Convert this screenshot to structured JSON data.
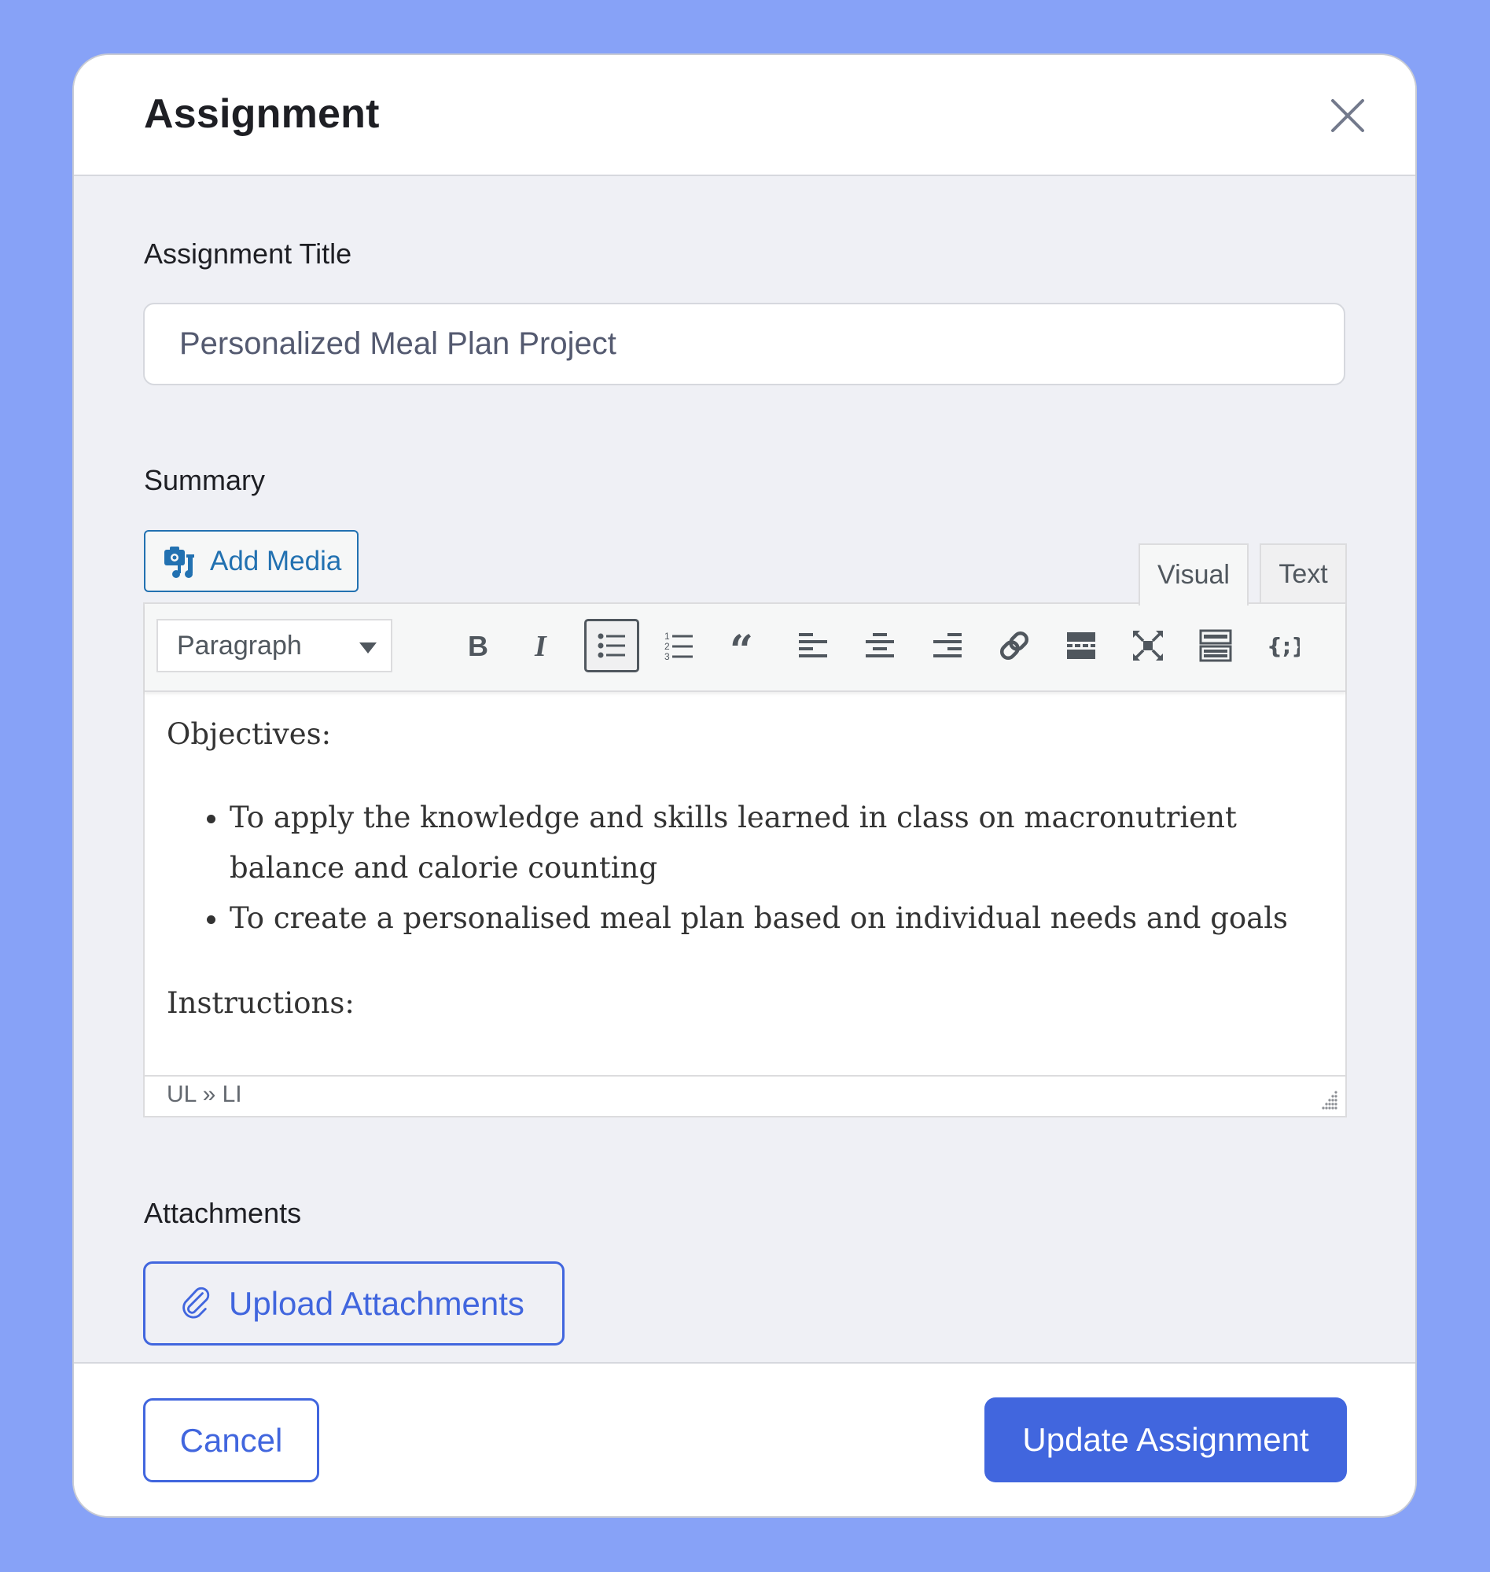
{
  "modal": {
    "title": "Assignment",
    "close_icon": "close-icon"
  },
  "fields": {
    "title_label": "Assignment Title",
    "title_value": "Personalized Meal Plan Project",
    "summary_label": "Summary",
    "attachments_label": "Attachments"
  },
  "editor": {
    "add_media_label": "Add Media",
    "tabs": [
      {
        "label": "Visual",
        "active": true
      },
      {
        "label": "Text",
        "active": false
      }
    ],
    "format_select": "Paragraph",
    "toolbar_icons": [
      "bold-icon",
      "italic-icon",
      "bullet-list-icon",
      "numbered-list-icon",
      "blockquote-icon",
      "align-left-icon",
      "align-center-icon",
      "align-right-icon",
      "link-icon",
      "read-more-icon",
      "fullscreen-icon",
      "toolbar-toggle-icon",
      "shortcode-icon"
    ],
    "active_tool": "bullet-list-icon",
    "content": {
      "heading1": "Objectives:",
      "bullets": [
        "To apply the knowledge and skills learned in class on macronutrient balance and calorie counting",
        "To create a personalised meal plan based on individual needs and goals"
      ],
      "heading2": "Instructions:"
    },
    "status_path": "UL » LI"
  },
  "attachments": {
    "upload_label": "Upload Attachments"
  },
  "footer": {
    "cancel_label": "Cancel",
    "update_label": "Update Assignment"
  },
  "colors": {
    "page_bg": "#87a2f7",
    "primary": "#4166de",
    "wp_blue": "#2271b1",
    "body_bg": "#eff0f5"
  }
}
